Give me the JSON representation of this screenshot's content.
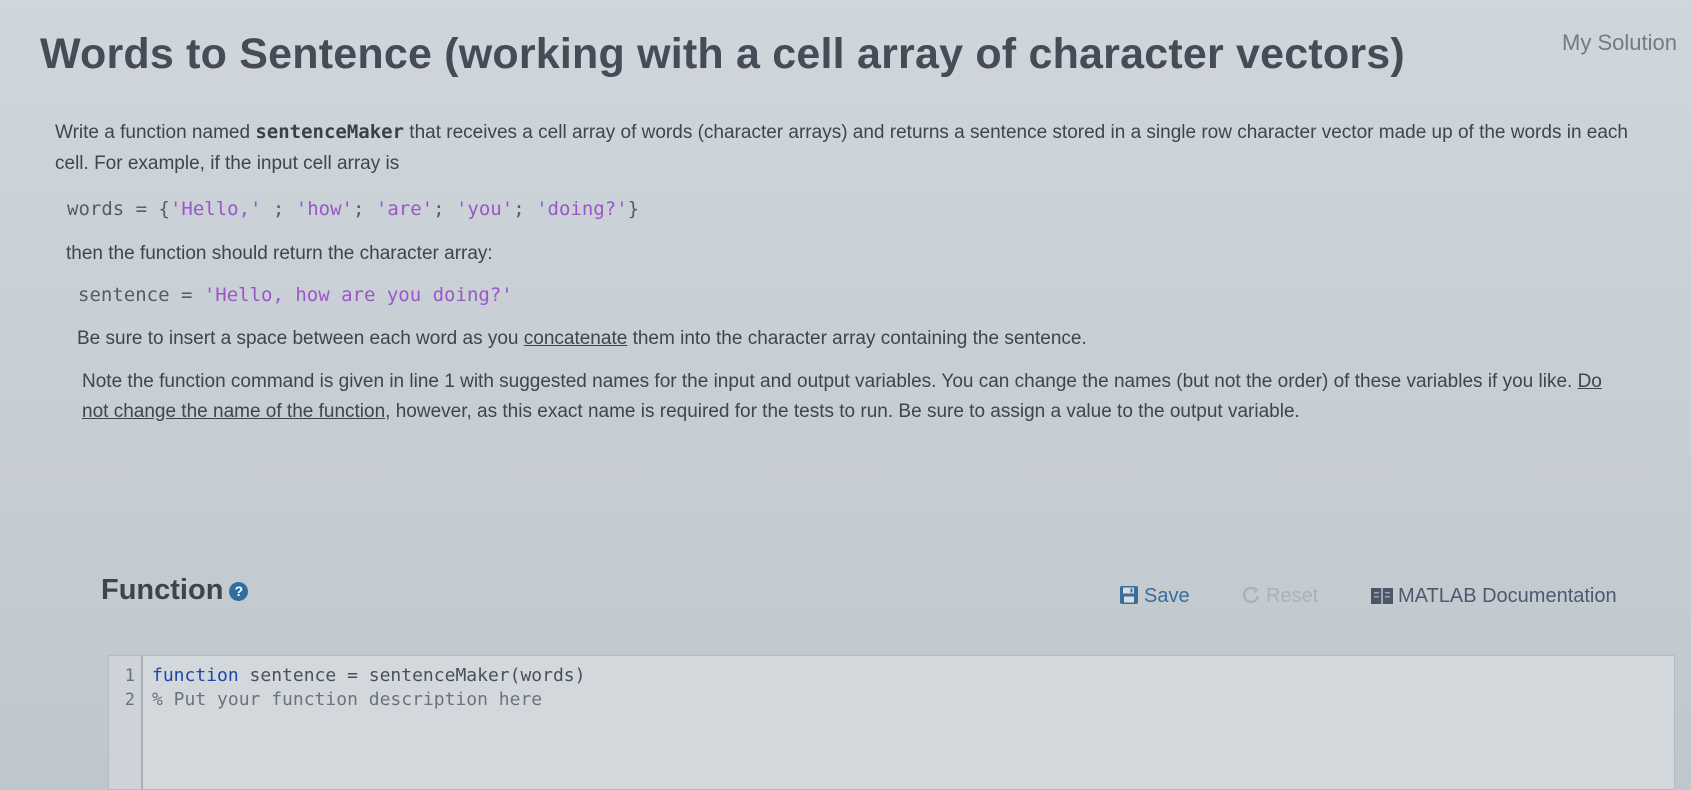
{
  "header": {
    "title": "Words to Sentence (working with a cell array of character vectors)",
    "my_solution": "My Solution"
  },
  "description": {
    "p1_a": "Write a function named ",
    "p1_fn": "sentenceMaker",
    "p1_b": " that receives a cell array of words (character arrays) and returns a sentence stored in a single row character vector made up of the words in each cell. For example, if the input cell array is",
    "code1_prefix": "words = {",
    "code1_s1": "'Hello,'",
    "code1_sep1": " ; ",
    "code1_s2": "'how'",
    "code1_sep2": "; ",
    "code1_s3": "'are'",
    "code1_sep3": "; ",
    "code1_s4": "'you'",
    "code1_sep4": "; ",
    "code1_s5": "'doing?'",
    "code1_suffix": "}",
    "p2": "then the function should return the character array:",
    "code2_prefix": "sentence = ",
    "code2_str": "'Hello, how are you doing?'",
    "p3_a": "Be sure to insert a space between each word as you ",
    "p3_link": "concatenate",
    "p3_b": " them into the character array containing the sentence.",
    "p4_a": "Note the function command is given in line 1 with suggested names for the input and output variables.  You can change the names (but not the order) of these variables if you like.  ",
    "p4_u": "Do not change the name of the function",
    "p4_b": ", however, as this exact name is required for the tests to run.  Be sure to assign a value to the output variable."
  },
  "function_section": {
    "title": "Function",
    "help_glyph": "?",
    "save_label": "Save",
    "reset_label": "Reset",
    "docs_label": "MATLAB Documentation"
  },
  "editor": {
    "lines": [
      {
        "num": "1",
        "keyword": "function",
        "rest": " sentence = sentenceMaker(words)"
      },
      {
        "num": "2",
        "comment": "% Put your function description here"
      }
    ]
  },
  "colors": {
    "save": "#3a6d98",
    "reset_disabled": "#a9b1bb",
    "string": "#9b56c8",
    "keyword": "#1f45a8"
  }
}
